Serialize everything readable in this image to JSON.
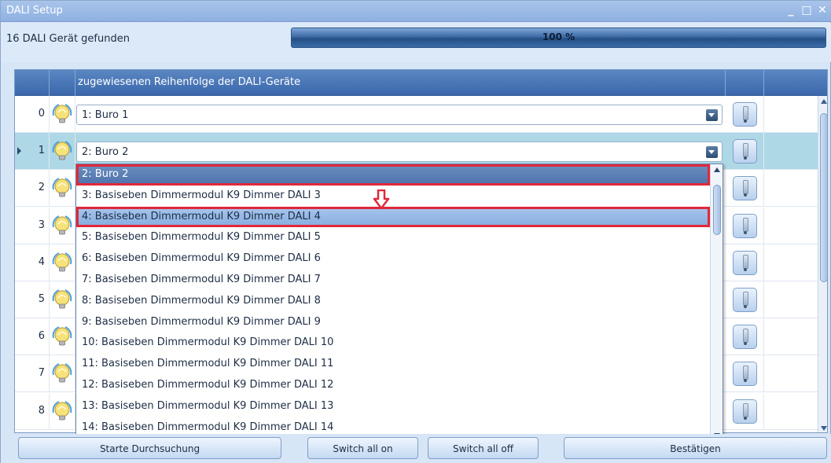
{
  "window": {
    "title": "DALI Setup",
    "controls": [
      "minimize-icon",
      "maximize-icon",
      "close-icon"
    ]
  },
  "status": {
    "found_text": "16 DALI Gerät gefunden",
    "progress_percent": 100,
    "progress_label": "100 %"
  },
  "grid": {
    "header_label": "zugewiesenen Reihenfolge der DALI-Geräte",
    "rows": [
      {
        "index": "0",
        "value": "1: Buro 1",
        "selected": false
      },
      {
        "index": "1",
        "value": "2: Buro 2",
        "selected": true
      },
      {
        "index": "2",
        "value": "",
        "selected": false
      },
      {
        "index": "3",
        "value": "",
        "selected": false
      },
      {
        "index": "4",
        "value": "",
        "selected": false
      },
      {
        "index": "5",
        "value": "",
        "selected": false
      },
      {
        "index": "6",
        "value": "",
        "selected": false
      },
      {
        "index": "7",
        "value": "",
        "selected": false
      },
      {
        "index": "8",
        "value": "",
        "selected": false
      }
    ]
  },
  "dropdown": {
    "options": [
      "2: Buro 2",
      "3: Basiseben Dimmermodul K9 Dimmer DALI 3",
      "4: Basiseben Dimmermodul K9 Dimmer DALI 4",
      "5: Basiseben Dimmermodul K9 Dimmer DALI 5",
      "6: Basiseben Dimmermodul K9 Dimmer DALI 6",
      "7: Basiseben Dimmermodul K9 Dimmer DALI 7",
      "8: Basiseben Dimmermodul K9 Dimmer DALI 8",
      "9: Basiseben Dimmermodul K9 Dimmer DALI 9",
      "10: Basiseben Dimmermodul K9 Dimmer DALI 10",
      "11: Basiseben Dimmermodul K9 Dimmer DALI 11",
      "12: Basiseben Dimmermodul K9 Dimmer DALI 12",
      "13: Basiseben Dimmermodul K9 Dimmer DALI 13",
      "14: Basiseben Dimmermodul K9 Dimmer DALI 14"
    ],
    "current_option": "2: Buro 2",
    "hovered_option": "4: Basiseben Dimmermodul K9 Dimmer DALI 4"
  },
  "buttons": {
    "start_search": "Starte Durchsuchung",
    "switch_all_on": "Switch all on",
    "switch_all_off": "Switch all off",
    "confirm": "Bestätigen"
  },
  "colors": {
    "accent": "#3b68ab",
    "selected_row": "#aed8e6",
    "annotation": "#e0283a"
  }
}
